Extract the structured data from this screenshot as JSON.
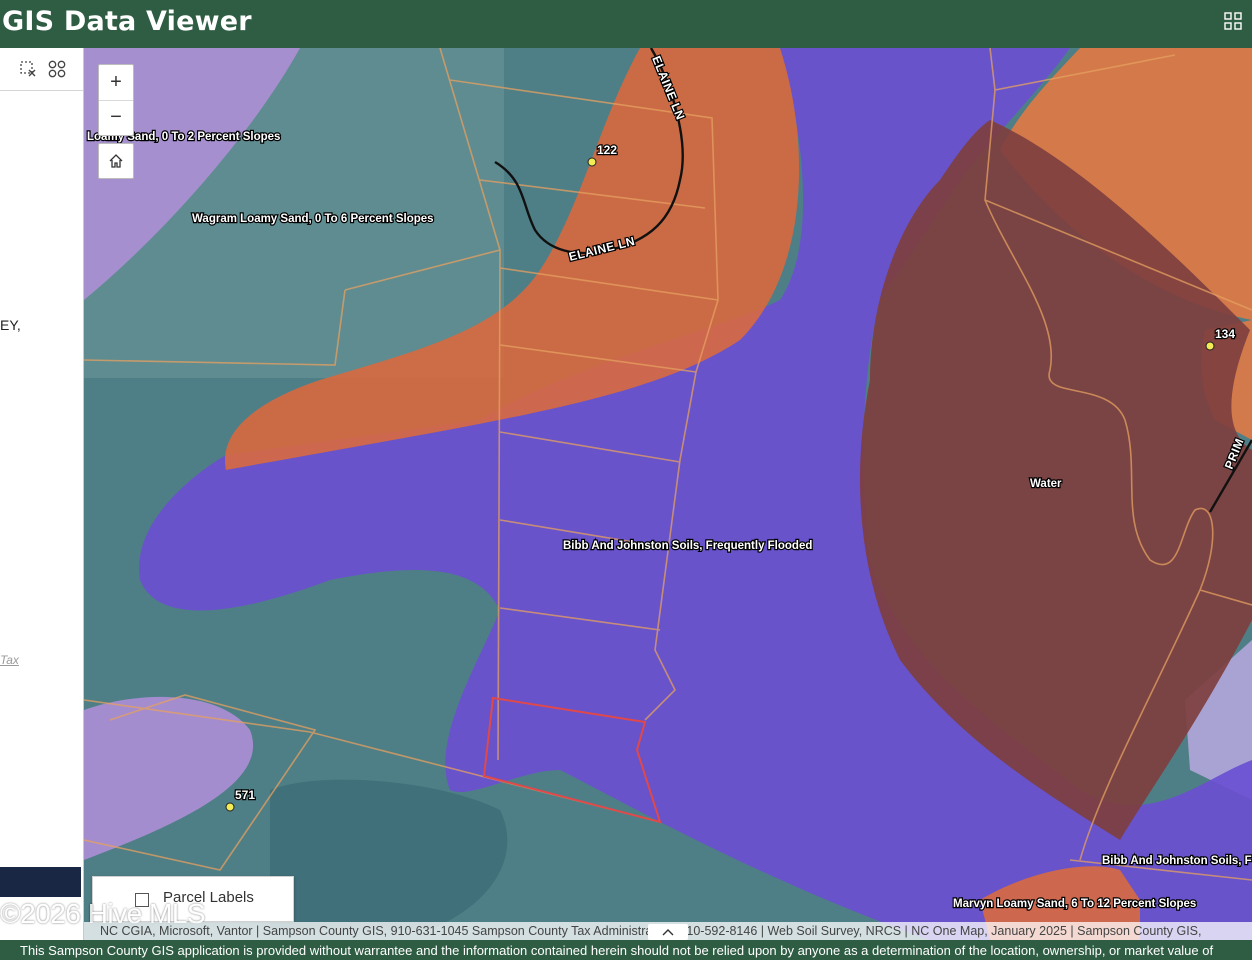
{
  "header": {
    "title": "GIS Data Viewer",
    "apps_icon": "app-launcher-grid-icon",
    "bg_color": "#2f5d43"
  },
  "sidebar": {
    "tools": [
      "select-clear-icon",
      "layout-grid-icon"
    ],
    "fragment_1": "EY,",
    "fragment_2": "Tax"
  },
  "map": {
    "zoom_in": "+",
    "zoom_out": "−",
    "home_icon": "home-icon",
    "soil_labels": {
      "loamy": "Loamy Sand, 0 To 2 Percent Slopes",
      "wagram": "Wagram Loamy Sand, 0 To 6 Percent Slopes",
      "bibb_center": "Bibb And Johnston Soils, Frequently Flooded",
      "water": "Water",
      "bibb_right": "Bibb And Johnston Soils, F",
      "marvyn": "Marvyn Loamy Sand, 6 To 12 Percent Slopes"
    },
    "road_labels": {
      "elaine_upper": "ELAINE LN",
      "elaine_lower": "ELAINE LN",
      "prim": "PRIM"
    },
    "addresses": [
      "122",
      "134",
      "571"
    ],
    "layers": {
      "parcel_labels_label": "Parcel Labels",
      "parcel_labels_checked": false
    },
    "colors": {
      "bibb": "#6a4fd1",
      "orange_soil": "#d8693f",
      "water_soil": "#7e3f3f",
      "selected_parcel": "#e0484a",
      "parcel_line": "#e6a060"
    }
  },
  "watermark": "©2026 Hive MLS",
  "attribution": "NC CGIA, Microsoft, Vantor | Sampson County GIS, 910-631-1045 Sampson County Tax Administration, 910-592-8146 | Web Soil Survey, NRCS | NC One Map, January 2025 | Sampson County GIS, ",
  "disclaimer": "This Sampson County GIS application is provided without warrantee and the information contained herein should not be relied upon by anyone as a determination of the location, ownership, or market value of"
}
